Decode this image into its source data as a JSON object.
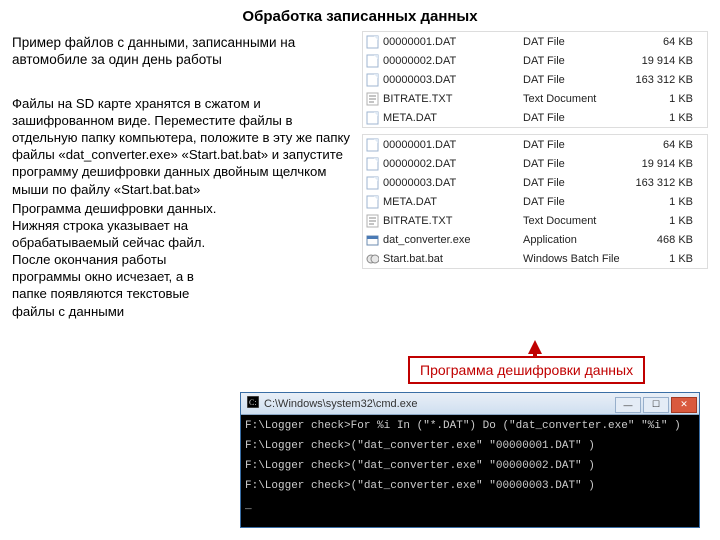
{
  "title": "Обработка записанных данных",
  "left": {
    "p1": "Пример файлов с данными, записанными на автомобиле за один день работы",
    "p2": "Файлы на  SD карте хранятся в сжатом и зашифрованном виде. Переместите файлы в отдельную папку компьютера, положите в эту же папку файлы «dat_converter.exe» «Start.bat.bat» и запустите программу дешифровки данных двойным щелчком мыши по файлу «Start.bat.bat»",
    "p3": "Программа дешифровки данных. Нижняя строка указывает на обрабатываемый сейчас файл. После окончания работы программы окно исчезает, а в папке появляются текстовые файлы с данными"
  },
  "callout": "Программа дешифровки данных",
  "pane1": [
    {
      "icon": "doc",
      "name": "00000001.DAT",
      "type": "DAT File",
      "size": "64 KB"
    },
    {
      "icon": "doc",
      "name": "00000002.DAT",
      "type": "DAT File",
      "size": "19 914 KB"
    },
    {
      "icon": "doc",
      "name": "00000003.DAT",
      "type": "DAT File",
      "size": "163 312 KB"
    },
    {
      "icon": "txt",
      "name": "BITRATE.TXT",
      "type": "Text Document",
      "size": "1 KB"
    },
    {
      "icon": "doc",
      "name": "META.DAT",
      "type": "DAT File",
      "size": "1 KB"
    }
  ],
  "pane2": [
    {
      "icon": "doc",
      "name": "00000001.DAT",
      "type": "DAT File",
      "size": "64 KB"
    },
    {
      "icon": "doc",
      "name": "00000002.DAT",
      "type": "DAT File",
      "size": "19 914 KB"
    },
    {
      "icon": "doc",
      "name": "00000003.DAT",
      "type": "DAT File",
      "size": "163 312 KB"
    },
    {
      "icon": "doc",
      "name": "META.DAT",
      "type": "DAT File",
      "size": "1 KB"
    },
    {
      "icon": "txt",
      "name": "BITRATE.TXT",
      "type": "Text Document",
      "size": "1 KB"
    },
    {
      "icon": "exe",
      "name": "dat_converter.exe",
      "type": "Application",
      "size": "468 KB"
    },
    {
      "icon": "bat",
      "name": "Start.bat.bat",
      "type": "Windows Batch File",
      "size": "1 KB"
    }
  ],
  "console": {
    "title": "C:\\Windows\\system32\\cmd.exe",
    "lines": [
      "F:\\Logger check>For %i In (\"*.DAT\") Do (\"dat_converter.exe\" \"%i\" )",
      "F:\\Logger check>(\"dat_converter.exe\" \"00000001.DAT\" )",
      "F:\\Logger check>(\"dat_converter.exe\" \"00000002.DAT\" )",
      "F:\\Logger check>(\"dat_converter.exe\" \"00000003.DAT\" )",
      "_"
    ]
  }
}
